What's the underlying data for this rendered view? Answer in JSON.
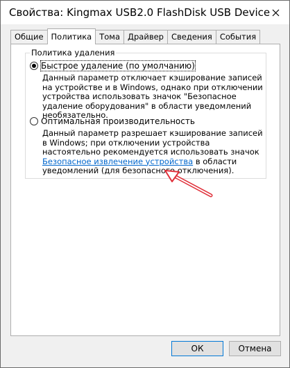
{
  "window": {
    "title": "Свойства: Kingmax USB2.0 FlashDisk USB Device",
    "close_icon": "close-icon"
  },
  "tabs": [
    {
      "label": "Общие",
      "active": false
    },
    {
      "label": "Политика",
      "active": true
    },
    {
      "label": "Тома",
      "active": false
    },
    {
      "label": "Драйвер",
      "active": false
    },
    {
      "label": "Сведения",
      "active": false
    },
    {
      "label": "События",
      "active": false
    }
  ],
  "policy": {
    "group_label": "Политика удаления",
    "quick_removal": {
      "label": "Быстрое удаление (по умолчанию)",
      "selected": true,
      "description": "Данный параметр отключает кэширование записей на устройстве и в Windows, однако при отключении устройства использовать значок \"Безопасное удаление оборудования\" в области уведомлений необязательно."
    },
    "better_performance": {
      "label": "Оптимальная производительность",
      "selected": false,
      "description_before": "Данный параметр разрешает кэширование записей в Windows; при отключении устройства настоятельно рекомендуется использовать значок ",
      "link": "Безопасное извлечение устройства",
      "description_after": " в области уведомлений (для безопасного отключения)."
    }
  },
  "annotation": {
    "arrow_color": "#e0303a"
  },
  "buttons": {
    "ok": "ОК",
    "cancel": "Отмена"
  }
}
